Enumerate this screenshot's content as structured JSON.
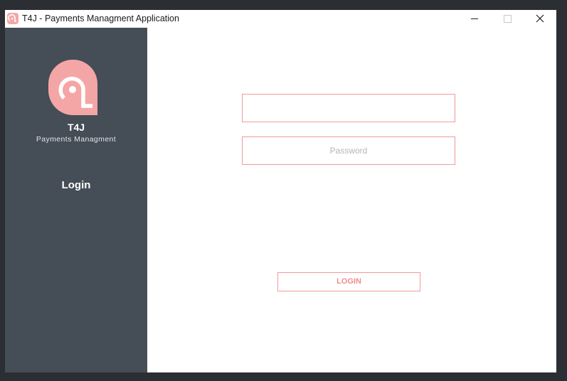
{
  "window": {
    "title": "T4J - Payments Managment Application",
    "icon": "app-logo-icon",
    "controls": [
      "minimize-icon",
      "maximize-icon",
      "close-icon"
    ]
  },
  "sidebar": {
    "logo_icon": "t4j-logo-icon",
    "brand_name": "T4J",
    "brand_subtitle": "Payments Managment",
    "nav_items": [
      {
        "label": "Login"
      }
    ],
    "background_color": "#454d56"
  },
  "form": {
    "username": {
      "value": "",
      "placeholder": ""
    },
    "password": {
      "value": "",
      "placeholder": "Password"
    },
    "login_button_label": "LOGIN",
    "accent_color": "#f09a9a"
  }
}
